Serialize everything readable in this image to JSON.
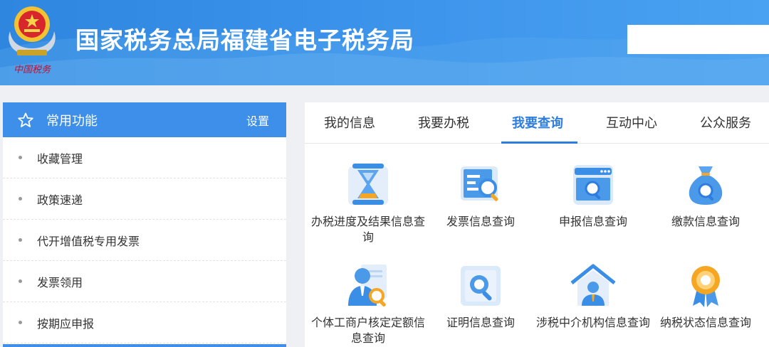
{
  "header": {
    "title": "国家税务总局福建省电子税务局",
    "emblem_text": "中国税务",
    "search_placeholder": ""
  },
  "favorites": {
    "title": "常用功能",
    "setting_label": "设置",
    "items": [
      {
        "label": "收藏管理"
      },
      {
        "label": "政策速递"
      },
      {
        "label": "代开增值税专用发票"
      },
      {
        "label": "发票领用"
      },
      {
        "label": "按期应申报"
      }
    ]
  },
  "tabs": [
    {
      "label": "我的信息",
      "active": false
    },
    {
      "label": "我要办税",
      "active": false
    },
    {
      "label": "我要查询",
      "active": true
    },
    {
      "label": "互动中心",
      "active": false
    },
    {
      "label": "公众服务",
      "active": false
    }
  ],
  "services": [
    {
      "label": "办税进度及结果信息查询",
      "icon": "hourglass-icon"
    },
    {
      "label": "发票信息查询",
      "icon": "invoice-search-icon"
    },
    {
      "label": "申报信息查询",
      "icon": "declaration-search-icon"
    },
    {
      "label": "缴款信息查询",
      "icon": "money-bag-search-icon"
    },
    {
      "label": "个体工商户核定定额信息查询",
      "icon": "person-search-icon"
    },
    {
      "label": "证明信息查询",
      "icon": "certificate-search-icon"
    },
    {
      "label": "涉税中介机构信息查询",
      "icon": "agency-building-icon"
    },
    {
      "label": "纳税状态信息查询",
      "icon": "status-medal-icon"
    }
  ],
  "colors": {
    "header_blue": "#3b92ea",
    "accent": "#2d7de0",
    "icon_light": "#dbeafb",
    "icon_orange": "#f5a623"
  }
}
